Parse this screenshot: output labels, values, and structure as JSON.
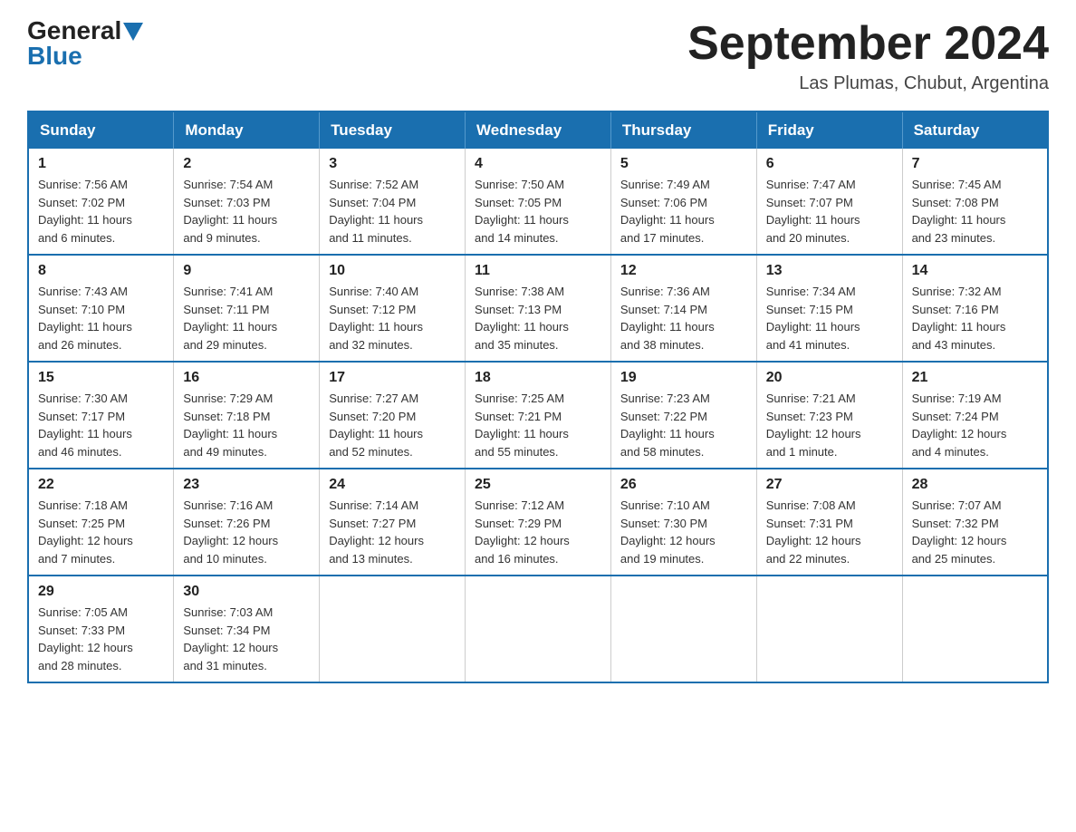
{
  "logo": {
    "general": "General",
    "blue": "Blue",
    "triangle": "▲"
  },
  "title": "September 2024",
  "location": "Las Plumas, Chubut, Argentina",
  "headers": [
    "Sunday",
    "Monday",
    "Tuesday",
    "Wednesday",
    "Thursday",
    "Friday",
    "Saturday"
  ],
  "weeks": [
    [
      {
        "day": "1",
        "info": "Sunrise: 7:56 AM\nSunset: 7:02 PM\nDaylight: 11 hours\nand 6 minutes."
      },
      {
        "day": "2",
        "info": "Sunrise: 7:54 AM\nSunset: 7:03 PM\nDaylight: 11 hours\nand 9 minutes."
      },
      {
        "day": "3",
        "info": "Sunrise: 7:52 AM\nSunset: 7:04 PM\nDaylight: 11 hours\nand 11 minutes."
      },
      {
        "day": "4",
        "info": "Sunrise: 7:50 AM\nSunset: 7:05 PM\nDaylight: 11 hours\nand 14 minutes."
      },
      {
        "day": "5",
        "info": "Sunrise: 7:49 AM\nSunset: 7:06 PM\nDaylight: 11 hours\nand 17 minutes."
      },
      {
        "day": "6",
        "info": "Sunrise: 7:47 AM\nSunset: 7:07 PM\nDaylight: 11 hours\nand 20 minutes."
      },
      {
        "day": "7",
        "info": "Sunrise: 7:45 AM\nSunset: 7:08 PM\nDaylight: 11 hours\nand 23 minutes."
      }
    ],
    [
      {
        "day": "8",
        "info": "Sunrise: 7:43 AM\nSunset: 7:10 PM\nDaylight: 11 hours\nand 26 minutes."
      },
      {
        "day": "9",
        "info": "Sunrise: 7:41 AM\nSunset: 7:11 PM\nDaylight: 11 hours\nand 29 minutes."
      },
      {
        "day": "10",
        "info": "Sunrise: 7:40 AM\nSunset: 7:12 PM\nDaylight: 11 hours\nand 32 minutes."
      },
      {
        "day": "11",
        "info": "Sunrise: 7:38 AM\nSunset: 7:13 PM\nDaylight: 11 hours\nand 35 minutes."
      },
      {
        "day": "12",
        "info": "Sunrise: 7:36 AM\nSunset: 7:14 PM\nDaylight: 11 hours\nand 38 minutes."
      },
      {
        "day": "13",
        "info": "Sunrise: 7:34 AM\nSunset: 7:15 PM\nDaylight: 11 hours\nand 41 minutes."
      },
      {
        "day": "14",
        "info": "Sunrise: 7:32 AM\nSunset: 7:16 PM\nDaylight: 11 hours\nand 43 minutes."
      }
    ],
    [
      {
        "day": "15",
        "info": "Sunrise: 7:30 AM\nSunset: 7:17 PM\nDaylight: 11 hours\nand 46 minutes."
      },
      {
        "day": "16",
        "info": "Sunrise: 7:29 AM\nSunset: 7:18 PM\nDaylight: 11 hours\nand 49 minutes."
      },
      {
        "day": "17",
        "info": "Sunrise: 7:27 AM\nSunset: 7:20 PM\nDaylight: 11 hours\nand 52 minutes."
      },
      {
        "day": "18",
        "info": "Sunrise: 7:25 AM\nSunset: 7:21 PM\nDaylight: 11 hours\nand 55 minutes."
      },
      {
        "day": "19",
        "info": "Sunrise: 7:23 AM\nSunset: 7:22 PM\nDaylight: 11 hours\nand 58 minutes."
      },
      {
        "day": "20",
        "info": "Sunrise: 7:21 AM\nSunset: 7:23 PM\nDaylight: 12 hours\nand 1 minute."
      },
      {
        "day": "21",
        "info": "Sunrise: 7:19 AM\nSunset: 7:24 PM\nDaylight: 12 hours\nand 4 minutes."
      }
    ],
    [
      {
        "day": "22",
        "info": "Sunrise: 7:18 AM\nSunset: 7:25 PM\nDaylight: 12 hours\nand 7 minutes."
      },
      {
        "day": "23",
        "info": "Sunrise: 7:16 AM\nSunset: 7:26 PM\nDaylight: 12 hours\nand 10 minutes."
      },
      {
        "day": "24",
        "info": "Sunrise: 7:14 AM\nSunset: 7:27 PM\nDaylight: 12 hours\nand 13 minutes."
      },
      {
        "day": "25",
        "info": "Sunrise: 7:12 AM\nSunset: 7:29 PM\nDaylight: 12 hours\nand 16 minutes."
      },
      {
        "day": "26",
        "info": "Sunrise: 7:10 AM\nSunset: 7:30 PM\nDaylight: 12 hours\nand 19 minutes."
      },
      {
        "day": "27",
        "info": "Sunrise: 7:08 AM\nSunset: 7:31 PM\nDaylight: 12 hours\nand 22 minutes."
      },
      {
        "day": "28",
        "info": "Sunrise: 7:07 AM\nSunset: 7:32 PM\nDaylight: 12 hours\nand 25 minutes."
      }
    ],
    [
      {
        "day": "29",
        "info": "Sunrise: 7:05 AM\nSunset: 7:33 PM\nDaylight: 12 hours\nand 28 minutes."
      },
      {
        "day": "30",
        "info": "Sunrise: 7:03 AM\nSunset: 7:34 PM\nDaylight: 12 hours\nand 31 minutes."
      },
      {
        "day": "",
        "info": ""
      },
      {
        "day": "",
        "info": ""
      },
      {
        "day": "",
        "info": ""
      },
      {
        "day": "",
        "info": ""
      },
      {
        "day": "",
        "info": ""
      }
    ]
  ]
}
